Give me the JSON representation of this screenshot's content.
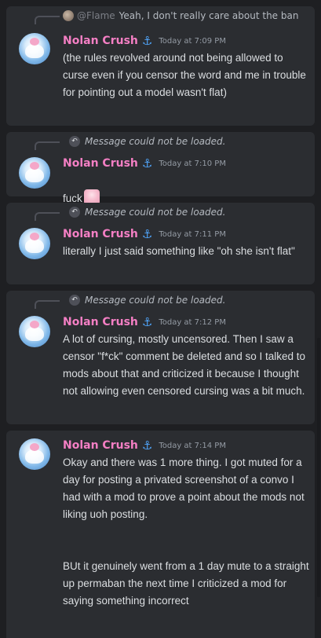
{
  "messages": [
    {
      "reply": {
        "author": "@Flame",
        "text": "Yeah, I don't really care about the ban"
      },
      "author": "Nolan Crush",
      "badge_icon": "anchor-icon",
      "timestamp": "Today at 7:09 PM",
      "text": "(the rules revolved around not being allowed to curse even if you censor the word and me in trouble for pointing out a model wasn't flat)"
    },
    {
      "reply": {
        "missing": "Message could not be loaded."
      },
      "author": "Nolan Crush",
      "badge_icon": "anchor-icon",
      "timestamp": "Today at 7:10 PM",
      "text": "fuck"
    },
    {
      "reply": {
        "missing": "Message could not be loaded."
      },
      "author": "Nolan Crush",
      "badge_icon": "anchor-icon",
      "timestamp": "Today at 7:11 PM",
      "text": "literally I just said something like \"oh she isn't flat\""
    },
    {
      "reply": {
        "missing": "Message could not be loaded."
      },
      "author": "Nolan Crush",
      "badge_icon": "anchor-icon",
      "timestamp": "Today at 7:12 PM",
      "text": "A lot of cursing, mostly uncensored. Then I saw a censor \"f*ck\" comment be deleted and so I talked to mods about that and criticized it because I thought not allowing even censored cursing was a bit much."
    },
    {
      "author": "Nolan Crush",
      "badge_icon": "anchor-icon",
      "timestamp": "Today at 7:14 PM",
      "text": "Okay and there was 1 more thing. I got muted for a day for posting a privated screenshot of a convo I had with a mod to prove a point about the mods not liking uoh posting.",
      "text_2": "BUt it genuinely went from a 1 day mute to a straight up permaban the next time I criticized a mod for saying something incorrect"
    }
  ],
  "glyphs": {
    "anchor": "⚓",
    "reply_arrow": "↶"
  },
  "colors": {
    "background": "#1e1f22",
    "card": "#2b2d31",
    "author": "#f47fc4",
    "badge": "#4fa3f7",
    "timestamp": "#949ba4",
    "text": "#dbdee1"
  }
}
